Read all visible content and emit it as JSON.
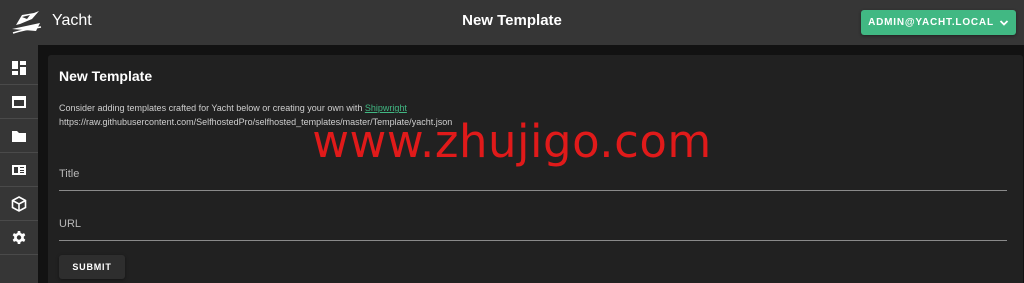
{
  "header": {
    "app_name": "Yacht",
    "page_title": "New Template",
    "user_button": "ADMIN@YACHT.LOCAL",
    "accent_color": "#41b883"
  },
  "sidebar": {
    "items": [
      {
        "icon": "dashboard-icon"
      },
      {
        "icon": "window-icon"
      },
      {
        "icon": "folder-icon"
      },
      {
        "icon": "newspaper-icon"
      },
      {
        "icon": "cube-icon"
      },
      {
        "icon": "gear-icon"
      }
    ]
  },
  "card": {
    "title": "New Template",
    "intro": "Consider adding templates crafted for Yacht below or creating your own with",
    "link_text": "Shipwright",
    "url_line": "https://raw.githubusercontent.com/SelfhostedPro/selfhosted_templates/master/Template/yacht.json",
    "fields": {
      "title_placeholder": "Title",
      "url_placeholder": "URL"
    },
    "submit_label": "SUBMIT"
  },
  "watermark": "www.zhujigo.com"
}
